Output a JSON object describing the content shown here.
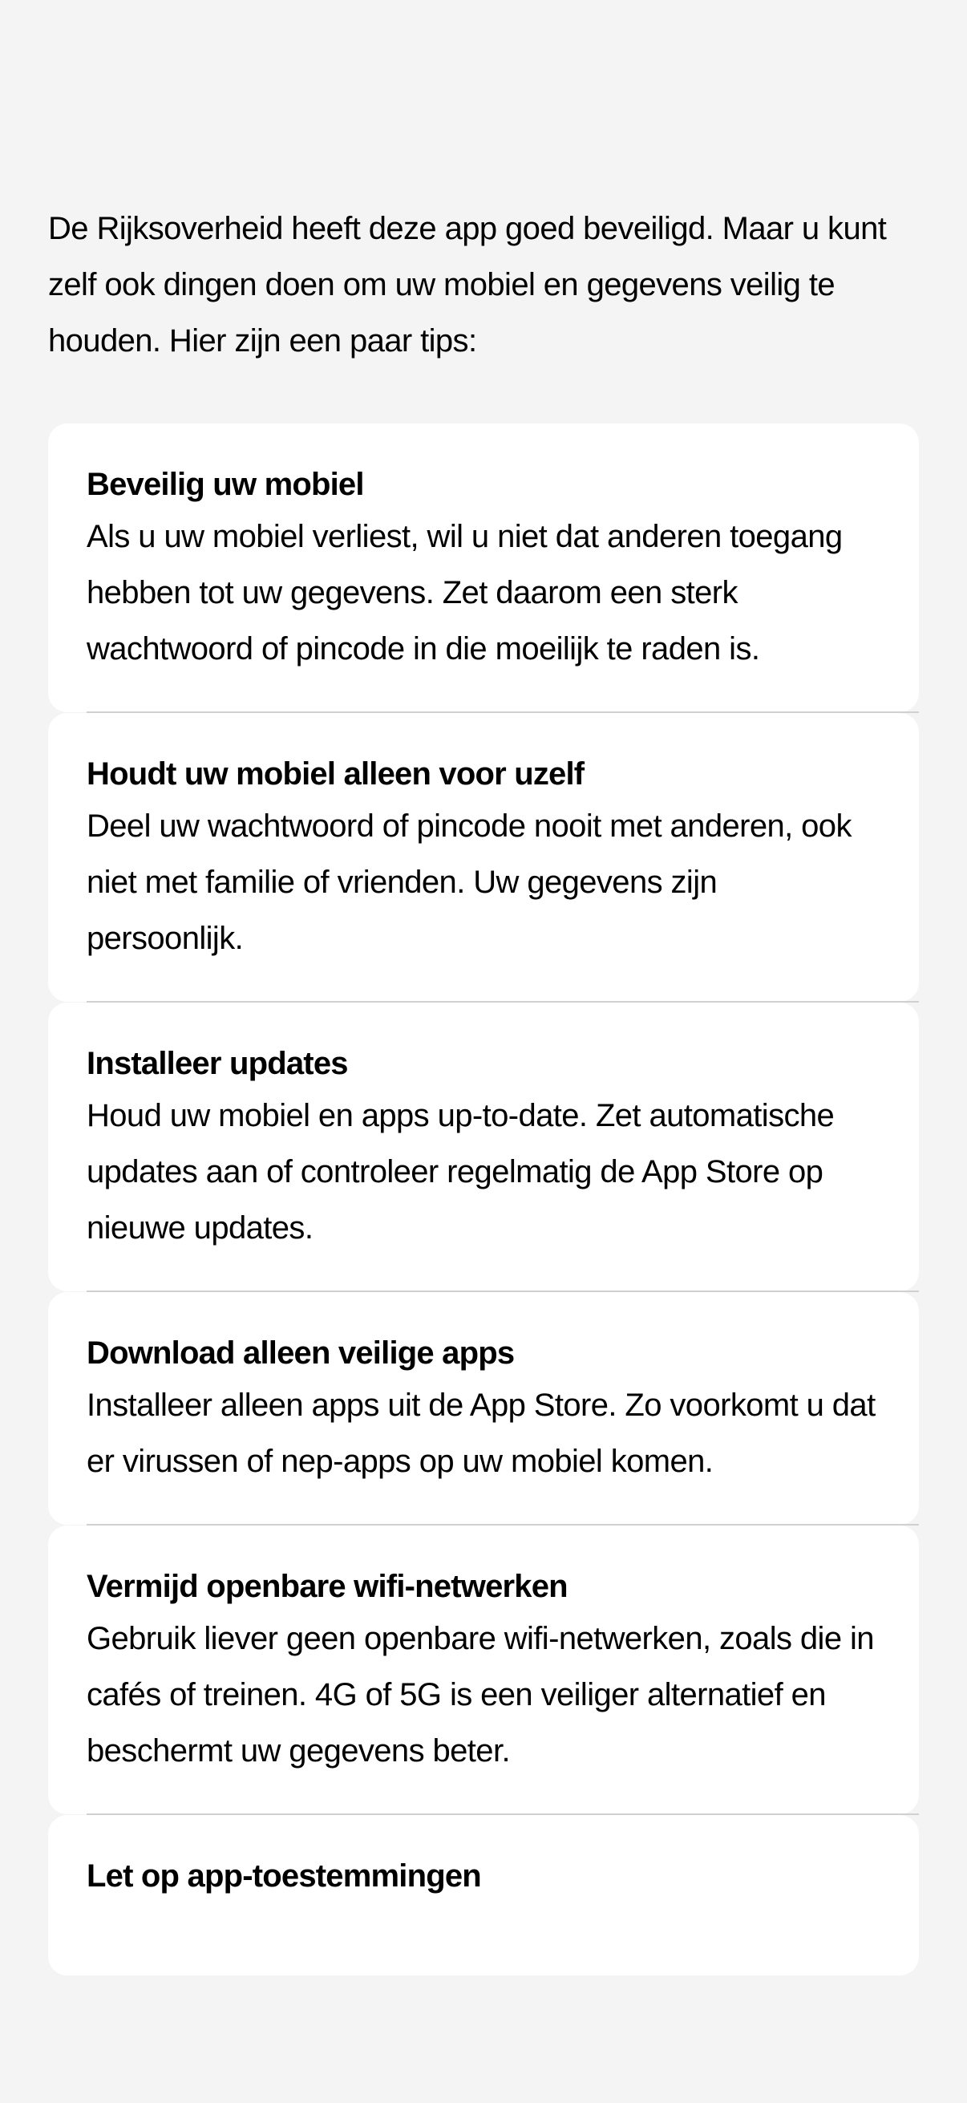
{
  "intro": "De Rijksoverheid heeft deze app goed beveiligd. Maar u kunt zelf ook dingen doen om uw mobiel en gegevens veilig te houden. Hier zijn een paar tips:",
  "tips": [
    {
      "title": "Beveilig uw mobiel",
      "body": "Als u uw mobiel verliest, wil u niet dat anderen toegang hebben tot uw gegevens. Zet daarom een sterk wachtwoord of pincode in die moeilijk te raden is."
    },
    {
      "title": "Houdt uw mobiel alleen voor uzelf",
      "body": "Deel uw wachtwoord of pincode nooit met anderen, ook niet met familie of vrienden. Uw gegevens zijn persoonlijk."
    },
    {
      "title": "Installeer updates",
      "body": "Houd uw mobiel en apps up-to-date. Zet automatische updates aan of controleer regelmatig de App Store op nieuwe updates."
    },
    {
      "title": "Download alleen veilige apps",
      "body": "Installeer alleen apps uit de App Store. Zo voorkomt u dat er virussen of nep-apps op uw mobiel komen."
    },
    {
      "title": "Vermijd openbare wifi-netwerken",
      "body": "Gebruik liever geen openbare wifi-netwerken, zoals die in cafés of treinen. 4G of 5G is een veiliger alternatief en beschermt uw gegevens beter."
    },
    {
      "title": "Let op app-toestemmingen",
      "body": ""
    }
  ]
}
